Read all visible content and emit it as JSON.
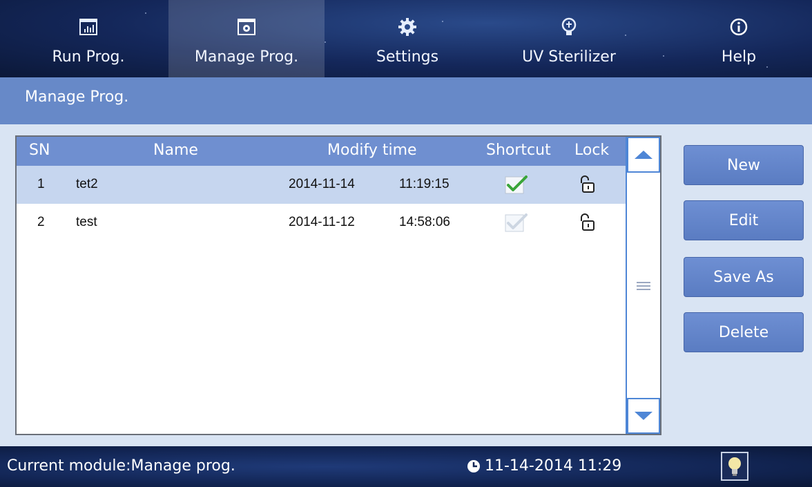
{
  "nav": [
    {
      "label": "Run Prog.",
      "icon": "chart-window-icon"
    },
    {
      "label": "Manage Prog.",
      "icon": "gear-window-icon",
      "active": true
    },
    {
      "label": "Settings",
      "icon": "gear-icon"
    },
    {
      "label": "UV Sterilizer",
      "icon": "lightbulb-icon"
    },
    {
      "label": "Help",
      "icon": "info-icon"
    }
  ],
  "page_title": "Manage Prog.",
  "table": {
    "headers": {
      "sn": "SN",
      "name": "Name",
      "modify_time": "Modify time",
      "shortcut": "Shortcut",
      "lock": "Lock"
    },
    "rows": [
      {
        "sn": "1",
        "name": "tet2",
        "date": "2014-11-14",
        "time": "11:19:15",
        "shortcut": true,
        "locked": false,
        "selected": true
      },
      {
        "sn": "2",
        "name": "test",
        "date": "2014-11-12",
        "time": "14:58:06",
        "shortcut": false,
        "locked": false,
        "selected": false
      }
    ]
  },
  "actions": {
    "new": "New",
    "edit": "Edit",
    "save_as": "Save As",
    "delete": "Delete"
  },
  "footer": {
    "module": "Current module:Manage prog.",
    "datetime": "11-14-2014 11:29"
  },
  "colors": {
    "accent": "#6f8fd0",
    "header_strip": "#6789c8",
    "selected_row": "#c6d6ef",
    "content_bg": "#d9e4f3",
    "check_green": "#3aa53a"
  }
}
